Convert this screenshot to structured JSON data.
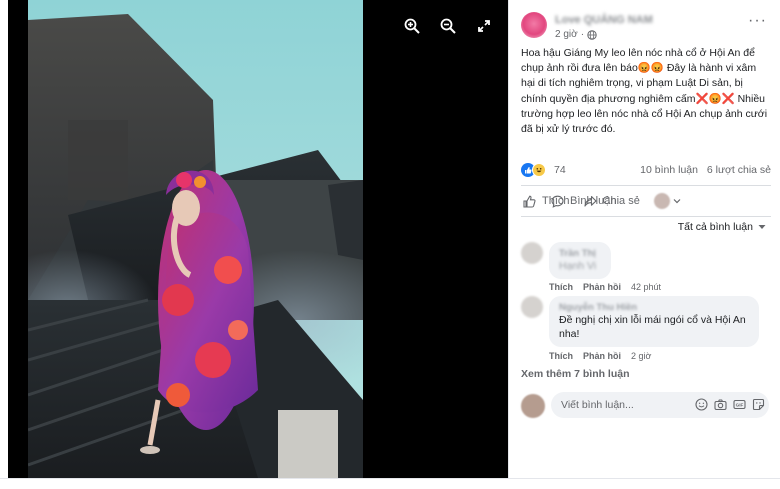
{
  "viewer": {
    "tools": [
      {
        "icon": "zoom-in-icon"
      },
      {
        "icon": "zoom-out-icon"
      },
      {
        "icon": "fullscreen-icon"
      }
    ]
  },
  "post": {
    "page_name": "Love QUẢNG NAM",
    "time": "2 giờ",
    "audience_icon": "globe-icon",
    "text": "Hoa hậu Giáng My leo lên nóc nhà cổ ở Hội An để chụp ảnh rồi đưa lên báo😡😡 Đây là hành vi xâm hại di tích nghiêm trọng, vi phạm Luật Di sản, bị chính quyền địa phương nghiêm cấm❌😡❌ Nhiều trường hợp leo lên nóc nhà cổ Hội An chụp ảnh cưới đã bị xử lý trước đó.",
    "reaction_count": "74",
    "comment_count": "10 bình luận",
    "share_count": "6 lượt chia sẻ"
  },
  "actions": {
    "like": "Thích",
    "comment": "Bình luận",
    "share": "Chia sẻ"
  },
  "comments_filter": "Tất cả bình luận",
  "comments": [
    {
      "name": "Trần Thị",
      "text": "Hạnh Vi",
      "like": "Thích",
      "reply": "Phản hồi",
      "time": "42 phút"
    },
    {
      "name": "Nguyễn Thu Hiền",
      "text": "Đề nghị chị xin lỗi mái ngói cổ và Hội An nha!",
      "like": "Thích",
      "reply": "Phản hồi",
      "time": "2 giờ"
    }
  ],
  "see_more": "Xem thêm 7 bình luận",
  "composer": {
    "placeholder": "Viết bình luận..."
  },
  "colors": {
    "accent": "#1877f2",
    "text": "#1c1e21",
    "muted": "#65676b",
    "bubble": "#f0f2f5"
  }
}
